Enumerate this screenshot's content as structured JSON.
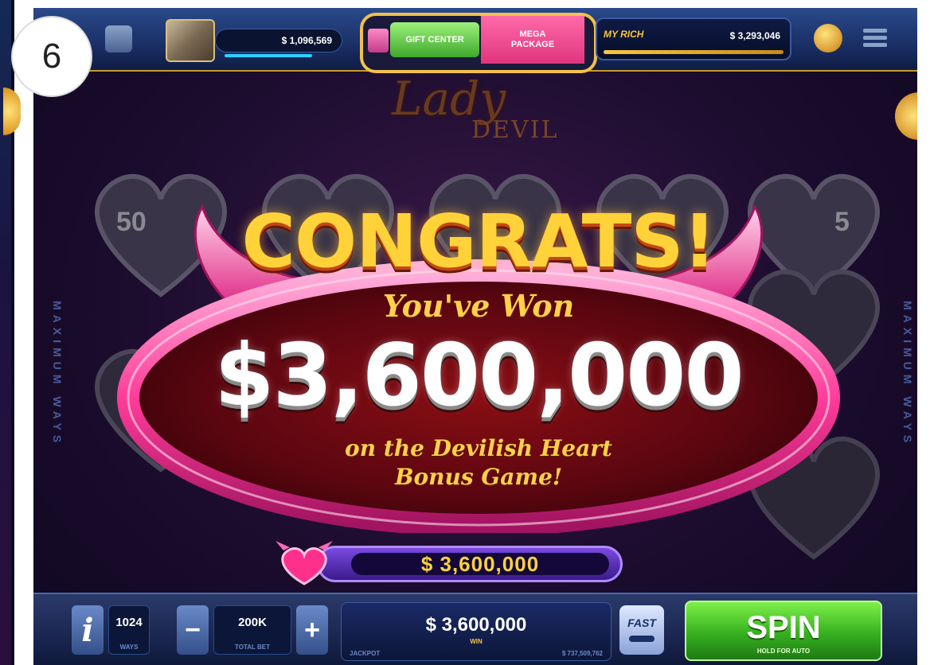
{
  "step_badge": "6",
  "topbar": {
    "balance": "$ 1,096,569",
    "gift_label": "GIFT CENTER",
    "mega_line1": "MEGA",
    "mega_line2": "PACKAGE",
    "jackpot_tag": "MY RICH",
    "jackpot_value": "$ 3,293,046"
  },
  "logo": {
    "script": "Lady",
    "name": "DEVIL"
  },
  "reels": {
    "side_label": "MAXIMUM WAYS",
    "left_num": "50",
    "right_num": "5"
  },
  "popup": {
    "headline": "CONGRATS!",
    "youve_won": "You've Won",
    "amount": "$3,600,000",
    "line1": "on the Devilish Heart",
    "line2": "Bonus Game!"
  },
  "win_bar": {
    "value": "$ 3,600,000"
  },
  "bottom": {
    "info": "i",
    "ways": "1024",
    "ways_label": "WAYS",
    "minus": "−",
    "bet": "200K",
    "bet_label": "TOTAL BET",
    "plus": "+",
    "win_value": "$ 3,600,000",
    "win_label": "WIN",
    "win_sub_left": "JACKPOT",
    "win_sub_right": "$ 737,509,762",
    "fast": "FAST",
    "spin": "SPIN",
    "spin_label": "HOLD FOR AUTO"
  },
  "colors": {
    "gold": "#ffd23a",
    "pink": "#ff4aa8",
    "spin_green": "#36b020",
    "bar_blue": "#1a2f66"
  }
}
